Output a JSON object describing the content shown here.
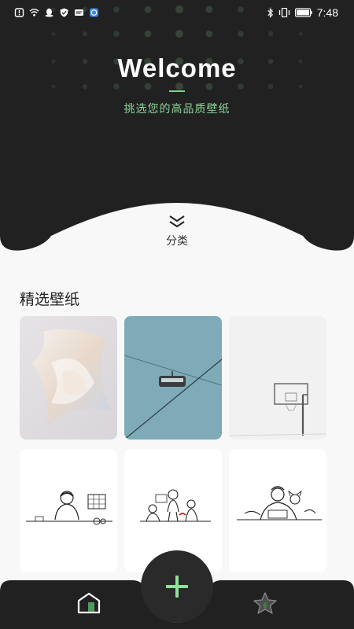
{
  "status_bar": {
    "time": "7:48",
    "left_icons": [
      "alert-icon",
      "wifi-icon",
      "qq-icon",
      "shield-icon",
      "mail-icon",
      "browser-icon"
    ],
    "right_icons": [
      "bluetooth-icon",
      "vibrate-icon",
      "battery-icon"
    ]
  },
  "hero": {
    "title": "Welcome",
    "subtitle": "挑选您的高品质壁纸",
    "accent_color": "#7ed58a",
    "category_label": "分类"
  },
  "section": {
    "title": "精选壁纸"
  },
  "wallpapers": [
    {
      "name": "glass-abstract"
    },
    {
      "name": "cable-car-sky"
    },
    {
      "name": "basketball-hoop"
    },
    {
      "name": "sketch-man-desk"
    },
    {
      "name": "sketch-family"
    },
    {
      "name": "sketch-father-child"
    }
  ],
  "bottom_nav": {
    "items": [
      "home-icon",
      "add-icon",
      "star-icon"
    ]
  }
}
